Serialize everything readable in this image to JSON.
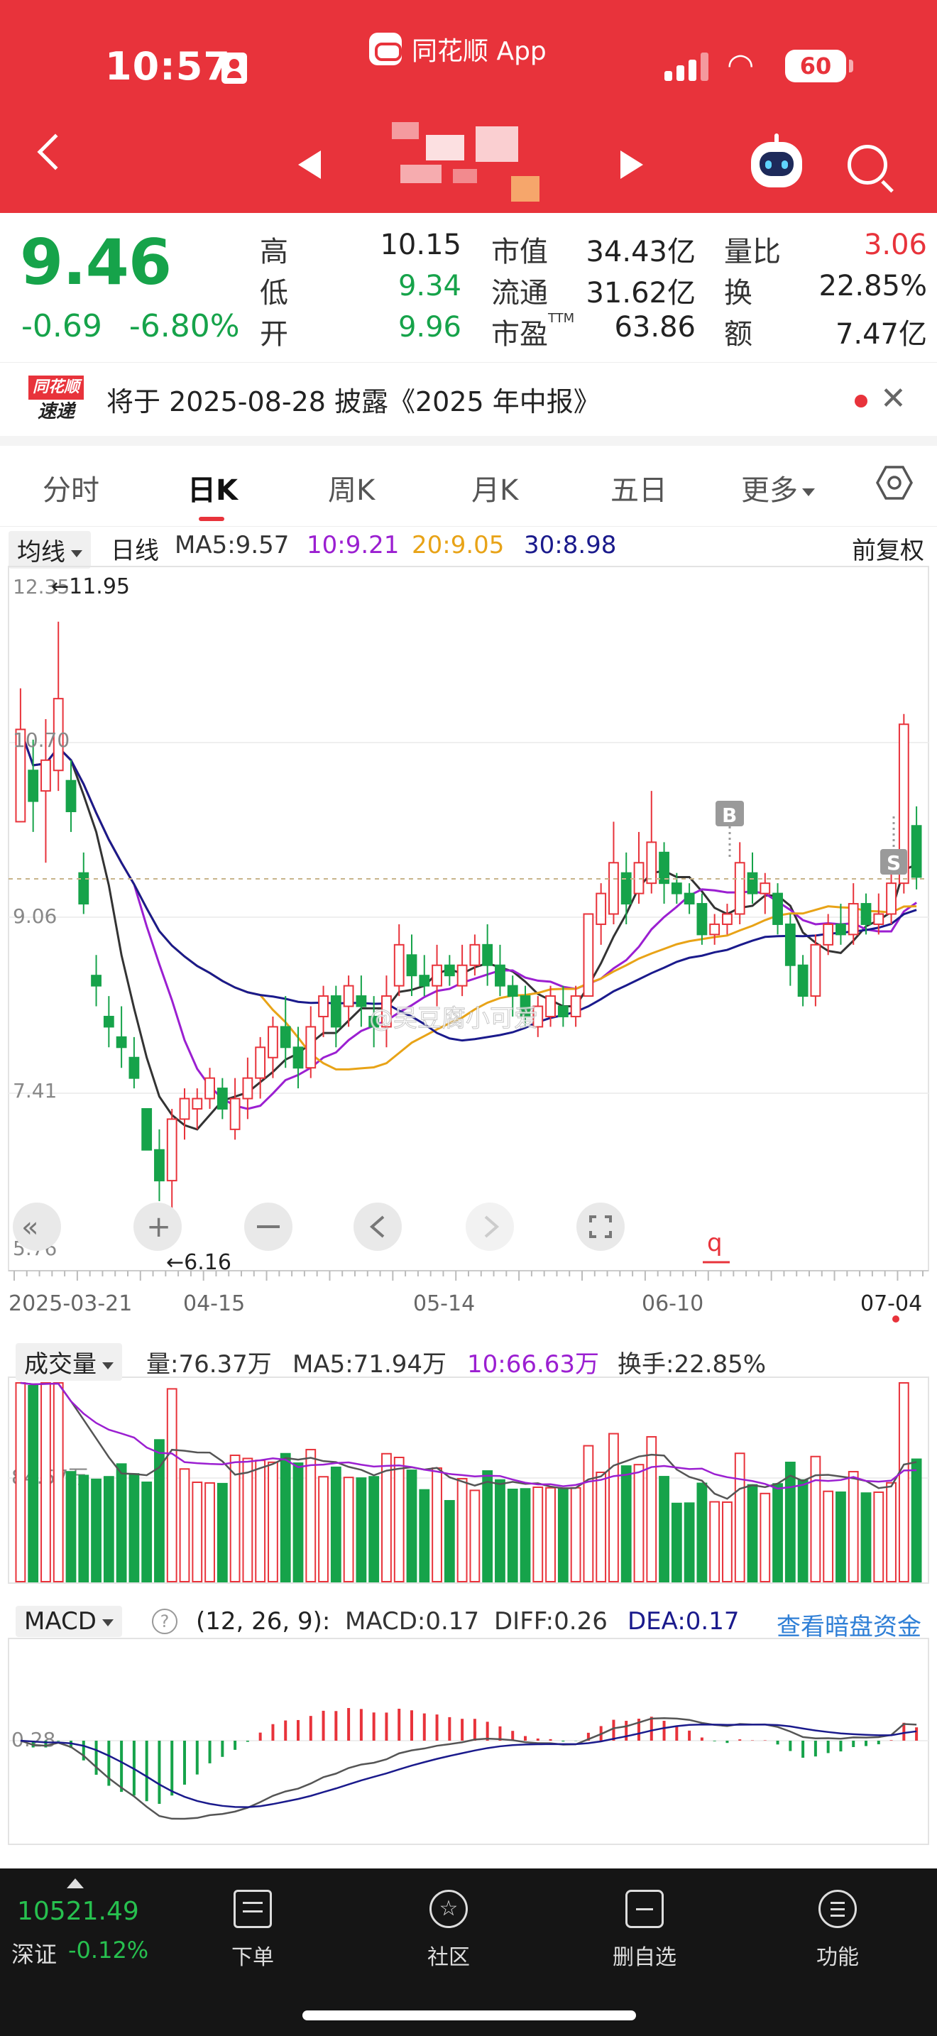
{
  "status_bar": {
    "time": "10:57",
    "app_name": "同花顺 App",
    "battery": "60"
  },
  "header": {
    "back_icon": "chevron-left-icon",
    "prev_icon": "triangle-left-icon",
    "next_icon": "triangle-right-icon",
    "assistant_icon": "robot-icon",
    "search_icon": "search-icon"
  },
  "quote": {
    "price": "9.46",
    "change": "-0.69",
    "change_pct": "-6.80%",
    "high_label": "高",
    "high": "10.15",
    "low_label": "低",
    "low": "9.34",
    "open_label": "开",
    "open": "9.96",
    "mcap_label": "市值",
    "mcap": "34.43亿",
    "float_label": "流通",
    "float": "31.62亿",
    "pe_label": "市盈",
    "pe_sup": "TTM",
    "pe": "63.86",
    "vr_label": "量比",
    "vr": "3.06",
    "turnover_label": "换",
    "turnover": "22.85%",
    "amount_label": "额",
    "amount": "7.47亿",
    "colors": {
      "down": "#16a34a",
      "up": "#e8333b"
    }
  },
  "news": {
    "logo_top": "同花顺",
    "logo_bottom": "速递",
    "text": "将于 2025-08-28 披露《2025 年中报》"
  },
  "tabs": [
    {
      "label": "分时"
    },
    {
      "label": "日K"
    },
    {
      "label": "周K"
    },
    {
      "label": "月K"
    },
    {
      "label": "五日"
    },
    {
      "label": "更多"
    }
  ],
  "ma_row": {
    "dropdown": "均线",
    "period": "日线",
    "ma5": "MA5:9.57",
    "ma10": "10:9.21",
    "ma20": "20:9.05",
    "ma30": "30:8.98",
    "adjust": "前复权"
  },
  "kline": {
    "y_labels": [
      "12.35",
      "10.70",
      "9.06",
      "7.41",
      "5.76"
    ],
    "max_marker": "←11.95",
    "min_marker": "←6.16",
    "x_labels": [
      "2025-03-21",
      "04-15",
      "05-14",
      "06-10",
      "07-04"
    ],
    "b_marker": "B",
    "s_marker": "S",
    "q_marker": "q",
    "watermark": "@吴豆腐小可爱"
  },
  "volume_row": {
    "dropdown": "成交量",
    "vol": "量:76.37万",
    "ma5": "MA5:71.94万",
    "ma10": "10:66.63万",
    "turn": "换手:22.85%",
    "axis_label": "84.57万"
  },
  "macd_row": {
    "dropdown": "MACD",
    "params": "(12, 26, 9):",
    "macd": "MACD:0.17",
    "diff": "DIFF:0.26",
    "dea": "DEA:0.17",
    "link": "查看暗盘资金",
    "axis_label": "0.28"
  },
  "bottom_nav": {
    "index_value": "10521.49",
    "index_name": "深证",
    "index_change": "-0.12%",
    "items": [
      {
        "label": "下单"
      },
      {
        "label": "社区"
      },
      {
        "label": "删自选"
      },
      {
        "label": "功能"
      }
    ]
  },
  "chart_data": {
    "type": "candlestick",
    "x_range": [
      "2025-03-21",
      "07-04"
    ],
    "ylim": [
      5.76,
      12.35
    ],
    "candles": [
      {
        "o": 10.0,
        "c": 10.9,
        "h": 11.3,
        "l": 10.0
      },
      {
        "o": 10.5,
        "c": 10.2,
        "h": 10.8,
        "l": 9.9
      },
      {
        "o": 10.3,
        "c": 10.6,
        "h": 11.0,
        "l": 9.6
      },
      {
        "o": 10.5,
        "c": 11.2,
        "h": 11.95,
        "l": 10.3
      },
      {
        "o": 10.4,
        "c": 10.1,
        "h": 10.6,
        "l": 9.9
      },
      {
        "o": 9.5,
        "c": 9.2,
        "h": 9.7,
        "l": 9.1
      },
      {
        "o": 8.5,
        "c": 8.4,
        "h": 8.7,
        "l": 8.2
      },
      {
        "o": 8.1,
        "c": 8.0,
        "h": 8.3,
        "l": 7.8
      },
      {
        "o": 7.9,
        "c": 7.8,
        "h": 8.2,
        "l": 7.6
      },
      {
        "o": 7.7,
        "c": 7.5,
        "h": 7.9,
        "l": 7.4
      },
      {
        "o": 7.2,
        "c": 6.8,
        "h": 7.2,
        "l": 6.8
      },
      {
        "o": 6.8,
        "c": 6.5,
        "h": 7.0,
        "l": 6.3
      },
      {
        "o": 6.5,
        "c": 7.1,
        "h": 7.2,
        "l": 6.16
      },
      {
        "o": 7.1,
        "c": 7.3,
        "h": 7.4,
        "l": 6.9
      },
      {
        "o": 7.2,
        "c": 7.3,
        "h": 7.4,
        "l": 7.0
      },
      {
        "o": 7.3,
        "c": 7.5,
        "h": 7.6,
        "l": 7.2
      },
      {
        "o": 7.4,
        "c": 7.2,
        "h": 7.5,
        "l": 7.1
      },
      {
        "o": 7.0,
        "c": 7.3,
        "h": 7.5,
        "l": 6.9
      },
      {
        "o": 7.3,
        "c": 7.5,
        "h": 7.7,
        "l": 7.1
      },
      {
        "o": 7.5,
        "c": 7.8,
        "h": 7.9,
        "l": 7.3
      },
      {
        "o": 7.7,
        "c": 8.0,
        "h": 8.1,
        "l": 7.5
      },
      {
        "o": 8.0,
        "c": 7.8,
        "h": 8.3,
        "l": 7.6
      },
      {
        "o": 7.8,
        "c": 7.6,
        "h": 8.0,
        "l": 7.4
      },
      {
        "o": 7.6,
        "c": 8.0,
        "h": 8.2,
        "l": 7.5
      },
      {
        "o": 8.1,
        "c": 8.3,
        "h": 8.4,
        "l": 7.9
      },
      {
        "o": 8.3,
        "c": 8.0,
        "h": 8.4,
        "l": 7.8
      },
      {
        "o": 8.2,
        "c": 8.4,
        "h": 8.5,
        "l": 8.0
      },
      {
        "o": 8.3,
        "c": 8.2,
        "h": 8.5,
        "l": 8.0
      },
      {
        "o": 8.1,
        "c": 8.0,
        "h": 8.3,
        "l": 7.8
      },
      {
        "o": 8.0,
        "c": 8.3,
        "h": 8.5,
        "l": 7.8
      },
      {
        "o": 8.4,
        "c": 8.8,
        "h": 9.0,
        "l": 8.3
      },
      {
        "o": 8.7,
        "c": 8.5,
        "h": 8.9,
        "l": 8.3
      },
      {
        "o": 8.5,
        "c": 8.4,
        "h": 8.7,
        "l": 8.3
      },
      {
        "o": 8.4,
        "c": 8.6,
        "h": 8.8,
        "l": 8.2
      },
      {
        "o": 8.6,
        "c": 8.5,
        "h": 8.7,
        "l": 8.4
      },
      {
        "o": 8.4,
        "c": 8.6,
        "h": 8.8,
        "l": 8.3
      },
      {
        "o": 8.6,
        "c": 8.8,
        "h": 8.9,
        "l": 8.5
      },
      {
        "o": 8.8,
        "c": 8.6,
        "h": 9.0,
        "l": 8.4
      },
      {
        "o": 8.6,
        "c": 8.4,
        "h": 8.8,
        "l": 8.3
      },
      {
        "o": 8.4,
        "c": 8.3,
        "h": 8.5,
        "l": 8.1
      },
      {
        "o": 8.3,
        "c": 8.1,
        "h": 8.4,
        "l": 8.0
      },
      {
        "o": 8.0,
        "c": 8.2,
        "h": 8.3,
        "l": 7.9
      },
      {
        "o": 8.1,
        "c": 8.3,
        "h": 8.4,
        "l": 8.0
      },
      {
        "o": 8.2,
        "c": 8.1,
        "h": 8.4,
        "l": 8.0
      },
      {
        "o": 8.1,
        "c": 8.3,
        "h": 8.4,
        "l": 8.0
      },
      {
        "o": 8.3,
        "c": 9.1,
        "h": 9.1,
        "l": 8.3
      },
      {
        "o": 9.0,
        "c": 9.3,
        "h": 9.4,
        "l": 8.8
      },
      {
        "o": 9.1,
        "c": 9.6,
        "h": 10.0,
        "l": 9.0
      },
      {
        "o": 9.5,
        "c": 9.2,
        "h": 9.7,
        "l": 9.0
      },
      {
        "o": 9.3,
        "c": 9.6,
        "h": 9.9,
        "l": 9.2
      },
      {
        "o": 9.4,
        "c": 9.8,
        "h": 10.3,
        "l": 9.3
      },
      {
        "o": 9.7,
        "c": 9.4,
        "h": 9.8,
        "l": 9.2
      },
      {
        "o": 9.4,
        "c": 9.3,
        "h": 9.5,
        "l": 9.2
      },
      {
        "o": 9.3,
        "c": 9.2,
        "h": 9.4,
        "l": 9.1
      },
      {
        "o": 9.2,
        "c": 8.9,
        "h": 9.3,
        "l": 8.8
      },
      {
        "o": 8.9,
        "c": 9.0,
        "h": 9.1,
        "l": 8.8
      },
      {
        "o": 9.0,
        "c": 9.1,
        "h": 9.2,
        "l": 8.9
      },
      {
        "o": 9.1,
        "c": 9.6,
        "h": 9.8,
        "l": 9.0
      },
      {
        "o": 9.5,
        "c": 9.3,
        "h": 9.7,
        "l": 9.2
      },
      {
        "o": 9.3,
        "c": 9.4,
        "h": 9.5,
        "l": 9.1
      },
      {
        "o": 9.3,
        "c": 9.0,
        "h": 9.4,
        "l": 8.9
      },
      {
        "o": 9.0,
        "c": 8.6,
        "h": 9.1,
        "l": 8.4
      },
      {
        "o": 8.6,
        "c": 8.3,
        "h": 8.7,
        "l": 8.2
      },
      {
        "o": 8.3,
        "c": 8.8,
        "h": 8.9,
        "l": 8.2
      },
      {
        "o": 8.8,
        "c": 9.0,
        "h": 9.1,
        "l": 8.7
      },
      {
        "o": 9.0,
        "c": 8.9,
        "h": 9.2,
        "l": 8.8
      },
      {
        "o": 8.9,
        "c": 9.2,
        "h": 9.4,
        "l": 8.8
      },
      {
        "o": 9.2,
        "c": 9.0,
        "h": 9.3,
        "l": 8.9
      },
      {
        "o": 9.0,
        "c": 9.1,
        "h": 9.3,
        "l": 8.9
      },
      {
        "o": 9.1,
        "c": 9.4,
        "h": 9.5,
        "l": 9.0
      },
      {
        "o": 9.4,
        "c": 10.95,
        "h": 11.05,
        "l": 9.3
      },
      {
        "o": 9.96,
        "c": 9.46,
        "h": 10.15,
        "l": 9.34
      }
    ],
    "ma_colors": {
      "ma5": "#333333",
      "ma10": "#9b1fd1",
      "ma20": "#e8a317",
      "ma30": "#1a1a8c"
    }
  }
}
